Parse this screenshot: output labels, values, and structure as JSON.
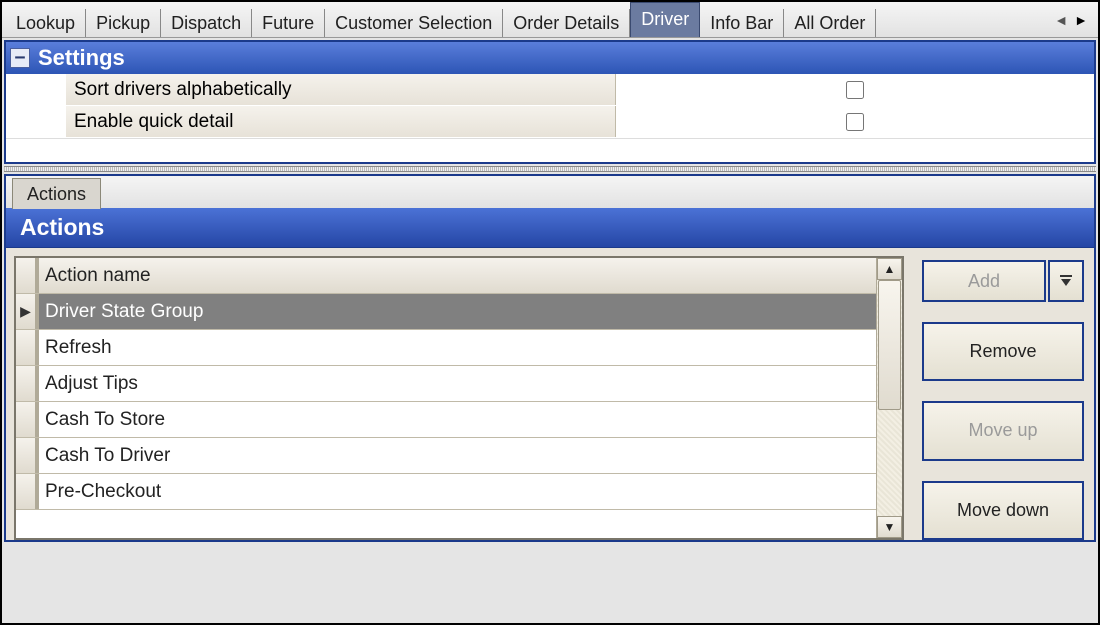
{
  "tabs": {
    "items": [
      "Lookup",
      "Pickup",
      "Dispatch",
      "Future",
      "Customer Selection",
      "Order Details",
      "Driver",
      "Info Bar",
      "All Order"
    ],
    "active_index": 6
  },
  "settings": {
    "title": "Settings",
    "rows": [
      {
        "label": "Sort drivers alphabetically",
        "checked": false
      },
      {
        "label": "Enable quick detail",
        "checked": false
      }
    ]
  },
  "subtab": {
    "label": "Actions"
  },
  "actions": {
    "title": "Actions",
    "column_header": "Action name",
    "rows": [
      {
        "name": "Driver State Group",
        "selected": true
      },
      {
        "name": "Refresh",
        "selected": false
      },
      {
        "name": "Adjust Tips",
        "selected": false
      },
      {
        "name": "Cash To Store",
        "selected": false
      },
      {
        "name": "Cash To Driver",
        "selected": false
      },
      {
        "name": "Pre-Checkout",
        "selected": false
      }
    ],
    "buttons": {
      "add": "Add",
      "remove": "Remove",
      "move_up": "Move up",
      "move_down": "Move down"
    }
  }
}
